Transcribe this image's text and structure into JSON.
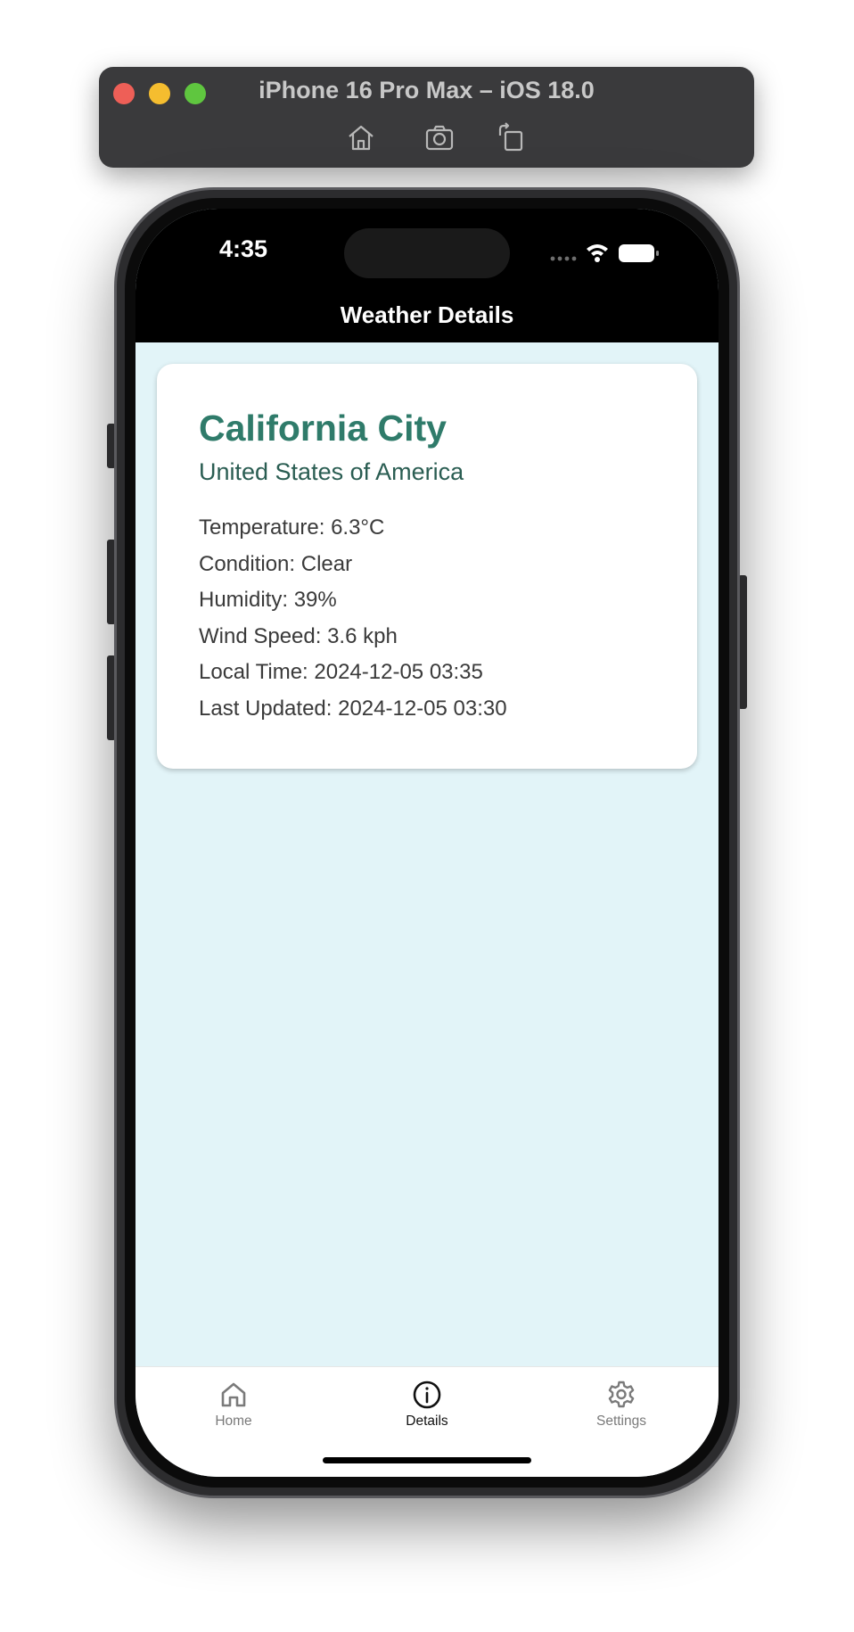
{
  "simulator": {
    "title": "iPhone 16 Pro Max – iOS 18.0",
    "tools": [
      "home-icon",
      "screenshot-icon",
      "rotate-icon"
    ]
  },
  "status_bar": {
    "time": "4:35"
  },
  "nav": {
    "title": "Weather Details"
  },
  "weather": {
    "city": "California City",
    "country": "United States of America",
    "details": [
      "Temperature: 6.3°C",
      "Condition: Clear",
      "Humidity: 39%",
      "Wind Speed: 3.6 kph",
      "Local Time: 2024-12-05 03:35",
      "Last Updated: 2024-12-05 03:30"
    ]
  },
  "tabs": [
    {
      "label": "Home",
      "icon": "home-icon",
      "active": false
    },
    {
      "label": "Details",
      "icon": "info-icon",
      "active": true
    },
    {
      "label": "Settings",
      "icon": "gear-icon",
      "active": false
    }
  ],
  "colors": {
    "city": "#2f7b6a",
    "country": "#2a5d52",
    "background": "#e2f4f8",
    "header": "#000000"
  }
}
